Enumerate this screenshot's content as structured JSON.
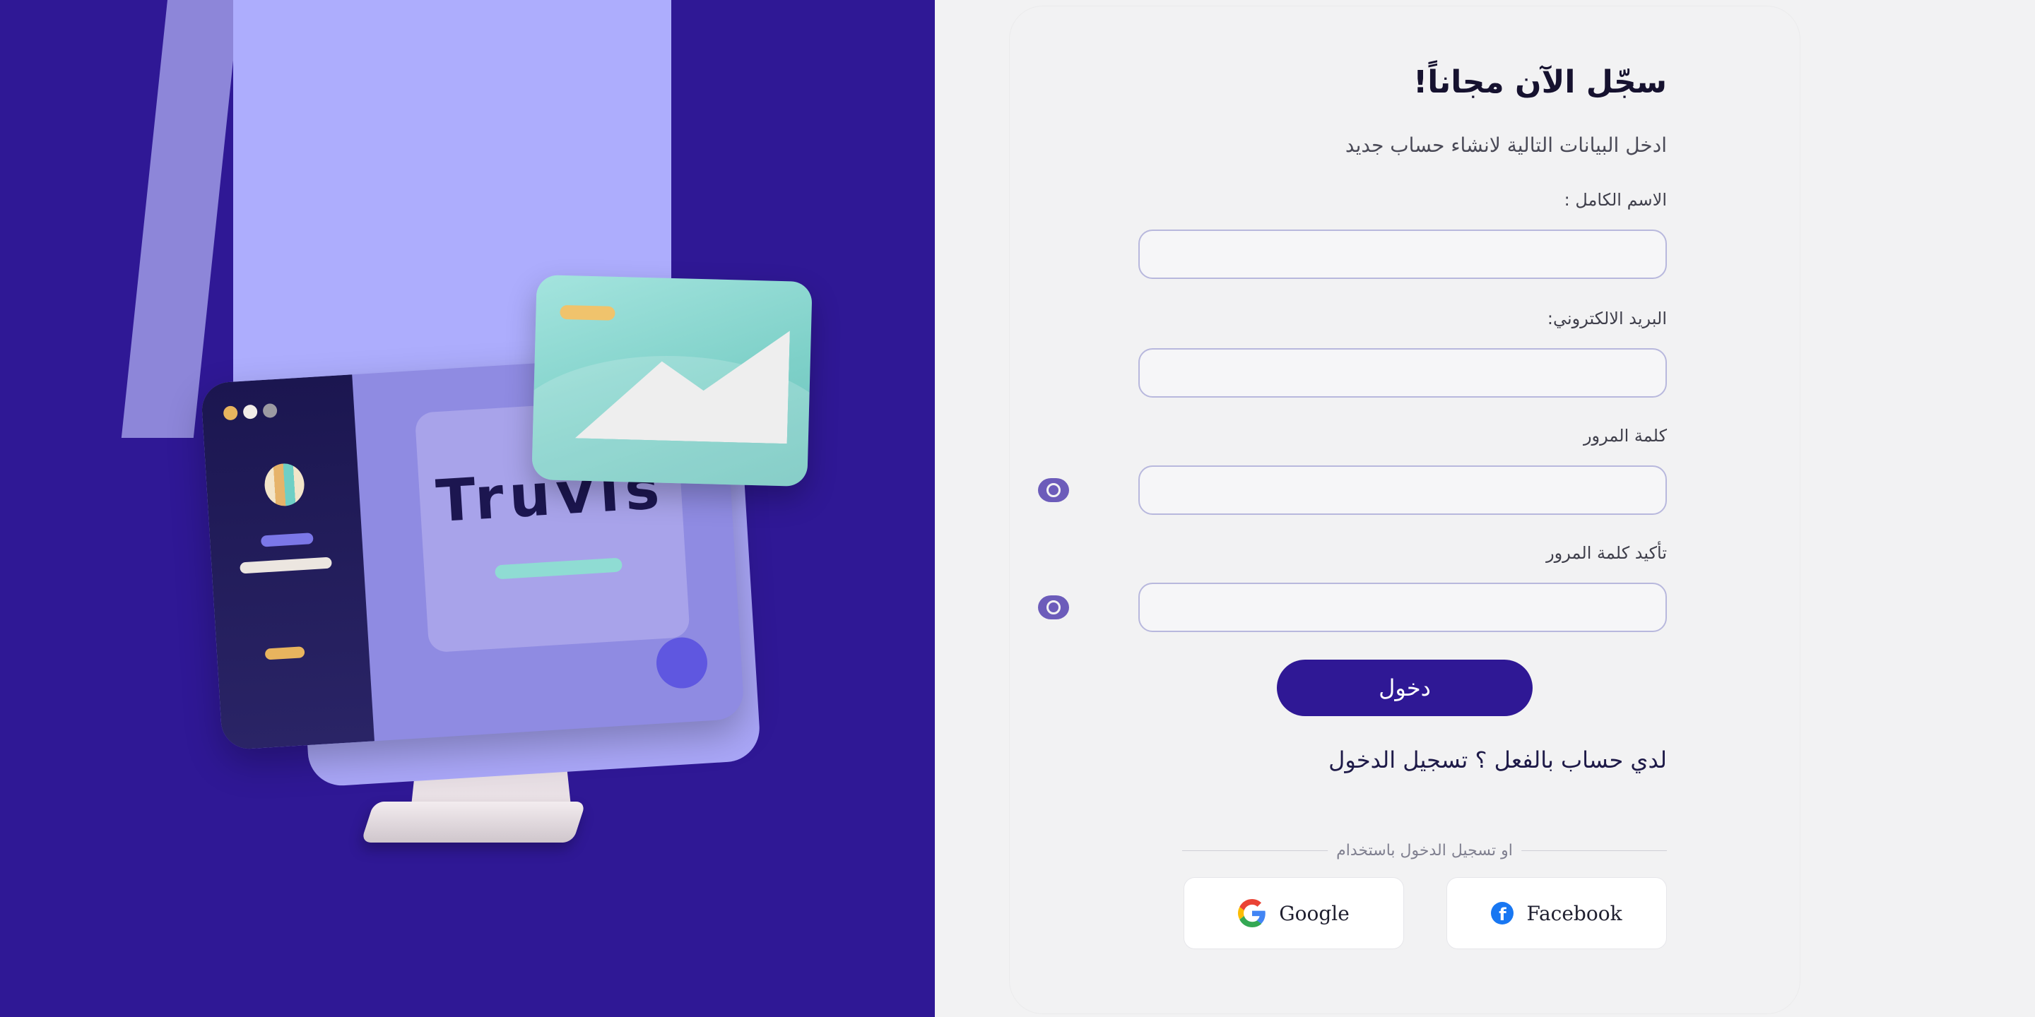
{
  "hero": {
    "brand_text": "Truvis",
    "colors": {
      "background": "#2f1895",
      "beam": "#adadfd",
      "photo_card": "#8fdcd3"
    }
  },
  "form": {
    "title": "سجّل الآن مجاناً!",
    "subtitle": "ادخل البيانات التالية لانشاء حساب جديد",
    "fields": {
      "full_name": {
        "label": "الاسم الكامل :",
        "value": "",
        "placeholder": ""
      },
      "email": {
        "label": "البريد الالكتروني:",
        "value": "",
        "placeholder": ""
      },
      "password": {
        "label": "كلمة المرور",
        "value": "",
        "placeholder": ""
      },
      "confirm_password": {
        "label": "تأكيد كلمة المرور",
        "value": "",
        "placeholder": ""
      }
    },
    "submit_label": "دخول",
    "login_prompt": "لدي حساب بالفعل ؟ تسجيل الدخول",
    "divider_text": "او تسجيل الدخول باستخدام",
    "social": {
      "facebook_label": "Facebook",
      "google_label": "Google",
      "facebook_icon": "facebook-icon",
      "google_icon": "google-icon"
    },
    "colors": {
      "primary": "#2f1895",
      "input_border": "#b8b8dd",
      "eye_icon": "#6c5cba"
    }
  }
}
